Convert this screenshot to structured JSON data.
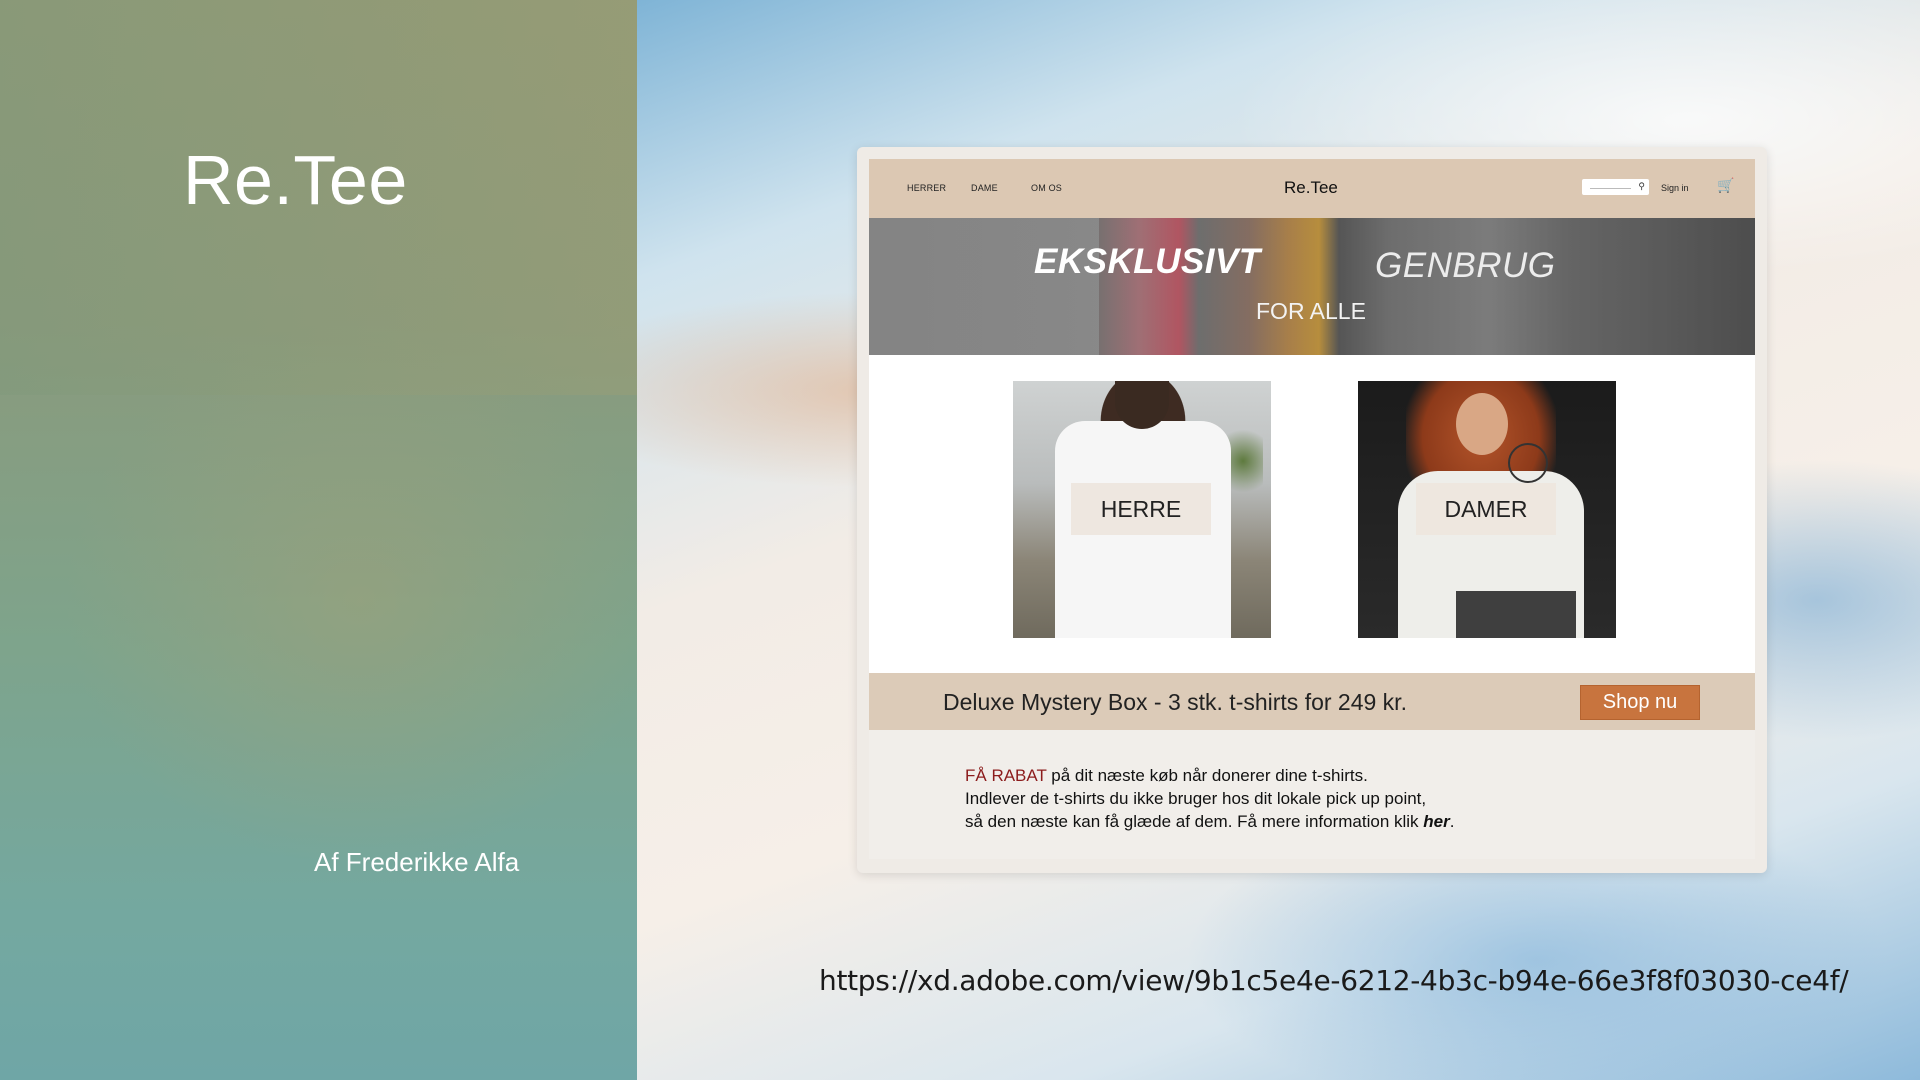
{
  "slide": {
    "title": "Re.Tee",
    "author": "Af Frederikke Alfa",
    "url": "https://xd.adobe.com/view/9b1c5e4e-6212-4b3c-b94e-66e3f8f03030-ce4f/"
  },
  "site": {
    "nav": {
      "links": [
        "HERRER",
        "DAME",
        "OM OS"
      ],
      "brand": "Re.Tee",
      "search_placeholder": "",
      "signin": "Sign in",
      "cart_icon": "cart-icon"
    },
    "hero": {
      "line1": "EKSKLUSIVT",
      "line2": "GENBRUG",
      "line3": "FOR ALLE"
    },
    "categories": [
      {
        "label": "HERRE"
      },
      {
        "label": "DAMER"
      }
    ],
    "promo": {
      "text": "Deluxe Mystery Box - 3 stk. t-shirts for 249 kr.",
      "button": "Shop nu"
    },
    "info": {
      "highlight": "FÅ RABAT",
      "line1_rest": " på dit næste køb når donerer dine t-shirts.",
      "line2": "Indlever de t-shirts du ikke bruger hos dit lokale pick up point,",
      "line3_start": "så den næste kan få glæde af dem. Få mere information klik ",
      "link": "her",
      "line3_end": "."
    }
  },
  "colors": {
    "nav_bg": "#dcc8b3",
    "promo_bg": "#dccbb8",
    "button": "#c8743e",
    "rabat": "#8c1c1c"
  }
}
